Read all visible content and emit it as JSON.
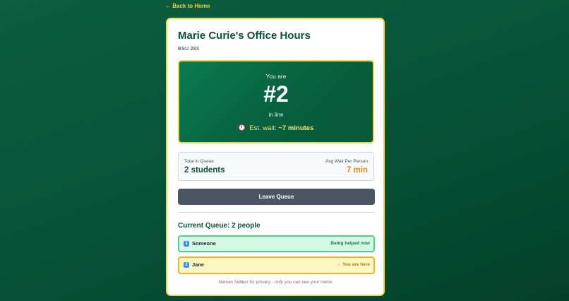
{
  "nav": {
    "back_label": "← Back to Home"
  },
  "office": {
    "title": "Marie Curie's Office Hours",
    "room": "BSU 283"
  },
  "position": {
    "prefix": "You are",
    "number": "#2",
    "suffix": "in line",
    "wait_label": "Est. wait:",
    "wait_value": "~7 minutes",
    "wait_icon": "alarm-clock-icon"
  },
  "stats": {
    "total_label": "Total in Queue",
    "total_value": "2 students",
    "avg_label": "Avg Wait Per Person",
    "avg_value": "7 min"
  },
  "actions": {
    "leave_label": "Leave Queue"
  },
  "queue": {
    "heading": "Current Queue: 2 people",
    "items": [
      {
        "number": "1",
        "name": "Someone",
        "status": "Being helped now"
      },
      {
        "number": "2",
        "name": "Jane",
        "status": "← You are here"
      }
    ],
    "privacy_note": "Names hidden for privacy - only you can see your name"
  },
  "colors": {
    "background": "#07543a",
    "accent_yellow": "#f0d440",
    "primary_green": "#0c4f37",
    "helped_green": "#57c98a",
    "you_yellow": "#eab52a",
    "wait_orange": "#d8901c"
  }
}
